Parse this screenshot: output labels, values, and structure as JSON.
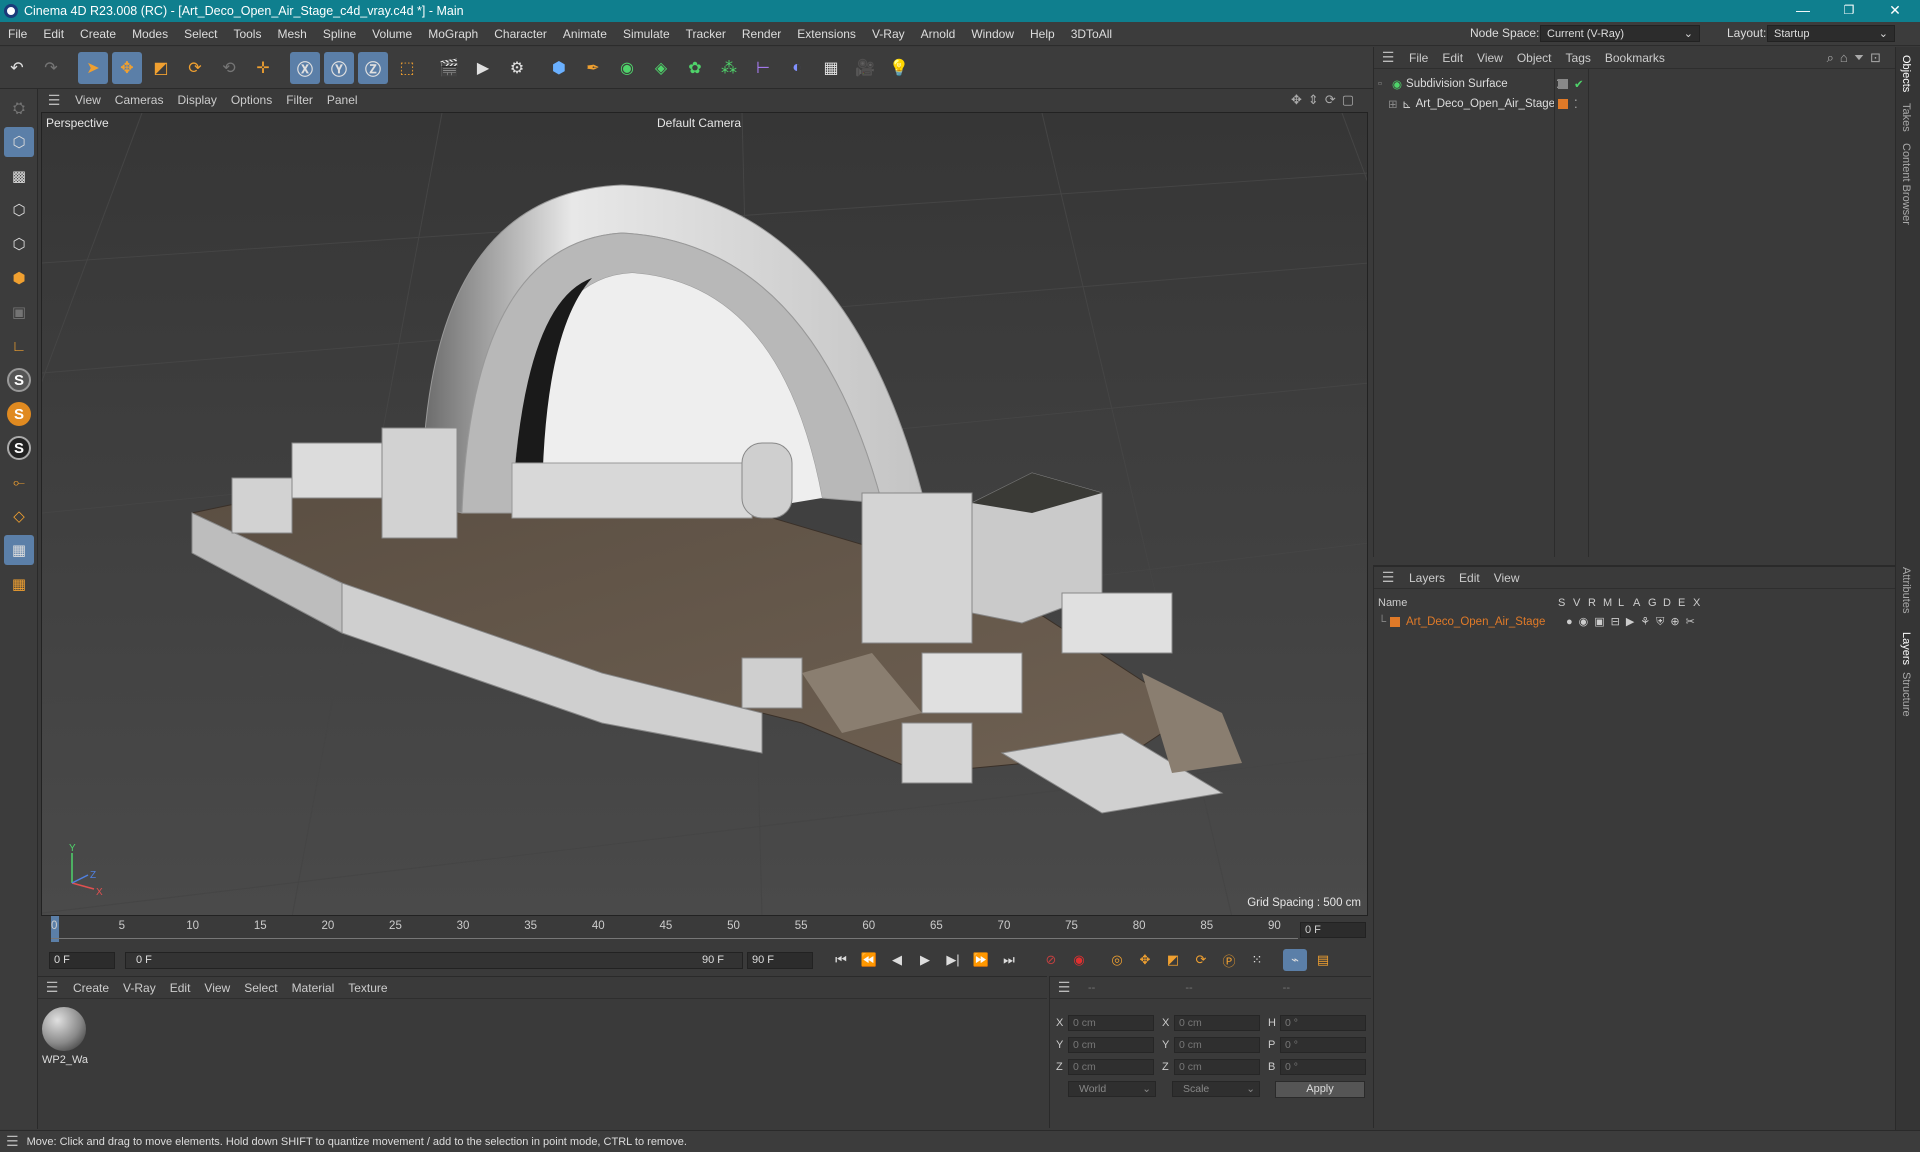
{
  "window": {
    "title": "Cinema 4D R23.008 (RC) - [Art_Deco_Open_Air_Stage_c4d_vray.c4d *] - Main",
    "minimize": "—",
    "maximize": "❐",
    "close": "✕"
  },
  "menubar": {
    "items": [
      "File",
      "Edit",
      "Create",
      "Modes",
      "Select",
      "Tools",
      "Mesh",
      "Spline",
      "Volume",
      "MoGraph",
      "Character",
      "Animate",
      "Simulate",
      "Tracker",
      "Render",
      "Extensions",
      "V-Ray",
      "Arnold",
      "Window",
      "Help",
      "3DToAll"
    ],
    "node_space_label": "Node Space:",
    "node_space_value": "Current (V-Ray)",
    "layout_label": "Layout:",
    "layout_value": "Startup"
  },
  "viewport": {
    "menu": [
      "View",
      "Cameras",
      "Display",
      "Options",
      "Filter",
      "Panel"
    ],
    "label": "Perspective",
    "camera": "Default Camera",
    "grid_spacing": "Grid Spacing : 500 cm"
  },
  "timeline": {
    "ticks": [
      "0",
      "5",
      "10",
      "15",
      "20",
      "25",
      "30",
      "35",
      "40",
      "45",
      "50",
      "55",
      "60",
      "65",
      "70",
      "75",
      "80",
      "85",
      "90"
    ],
    "current_frame": "0 F"
  },
  "playbar": {
    "start": "0 F",
    "range_start": "0 F",
    "range_end": "90 F",
    "end": "90 F"
  },
  "material_panel": {
    "menu": [
      "Create",
      "V-Ray",
      "Edit",
      "View",
      "Select",
      "Material",
      "Texture"
    ],
    "material_name": "WP2_Wa"
  },
  "coords": {
    "headers": [
      "--",
      "--",
      "--"
    ],
    "rows": [
      {
        "l1": "X",
        "v1": "0 cm",
        "l2": "X",
        "v2": "0 cm",
        "l3": "H",
        "v3": "0 °"
      },
      {
        "l1": "Y",
        "v1": "0 cm",
        "l2": "Y",
        "v2": "0 cm",
        "l3": "P",
        "v3": "0 °"
      },
      {
        "l1": "Z",
        "v1": "0 cm",
        "l2": "Z",
        "v2": "0 cm",
        "l3": "B",
        "v3": "0 °"
      }
    ],
    "space": "World",
    "mode": "Scale",
    "apply": "Apply"
  },
  "object_panel": {
    "menu": [
      "File",
      "Edit",
      "View",
      "Object",
      "Tags",
      "Bookmarks"
    ],
    "objects": [
      "Subdivision Surface",
      "Art_Deco_Open_Air_Stage"
    ]
  },
  "layer_panel": {
    "menu": [
      "Layers",
      "Edit",
      "View"
    ],
    "name_header": "Name",
    "flags": [
      "S",
      "V",
      "R",
      "M",
      "L",
      "A",
      "G",
      "D",
      "E",
      "X"
    ],
    "layers": [
      "Art_Deco_Open_Air_Stage"
    ]
  },
  "side_tabs": [
    "Objects",
    "Takes",
    "Content Browser",
    "Attributes",
    "Layers",
    "Structure"
  ],
  "status": "Move: Click and drag to move elements. Hold down SHIFT to quantize movement / add to the selection in point mode, CTRL to remove.",
  "colors": {
    "accent": "#5b7fa8",
    "title": "#0f7f8e",
    "layer": "#e07a28",
    "orange": "#f0a030"
  }
}
